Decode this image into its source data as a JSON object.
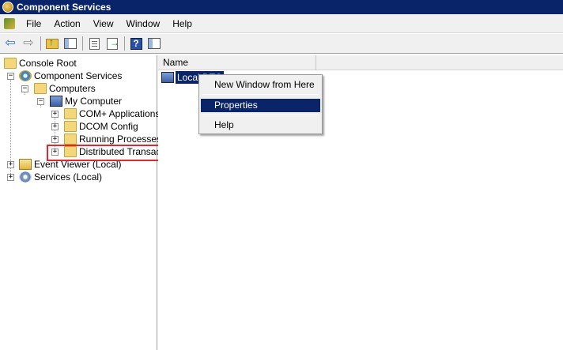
{
  "window": {
    "title": "Component Services"
  },
  "menubar": {
    "items": [
      "File",
      "Action",
      "View",
      "Window",
      "Help"
    ]
  },
  "toolbar": {
    "buttons": [
      "back-icon",
      "forward-icon",
      "up-folder-icon",
      "show-hide-tree-icon",
      "properties-icon",
      "export-list-icon",
      "help-icon",
      "show-hide-action-pane-icon"
    ]
  },
  "tree": {
    "console_root": "Console Root",
    "component_services": "Component Services",
    "computers": "Computers",
    "my_computer": "My Computer",
    "com_plus": "COM+ Applications",
    "dcom_config": "DCOM Config",
    "running_processes": "Running Processes",
    "distributed_transac": "Distributed Transac",
    "event_viewer": "Event Viewer (Local)",
    "services": "Services (Local)",
    "expander_plus": "+",
    "expander_minus": "−"
  },
  "list": {
    "column_name": "Name",
    "row_label": "Local DTC"
  },
  "context_menu": {
    "items": [
      "New Window from Here",
      "Properties",
      "Help"
    ],
    "selected": "Properties"
  },
  "colors": {
    "selection": "#0a246a",
    "highlight_box": "#e0282e"
  }
}
